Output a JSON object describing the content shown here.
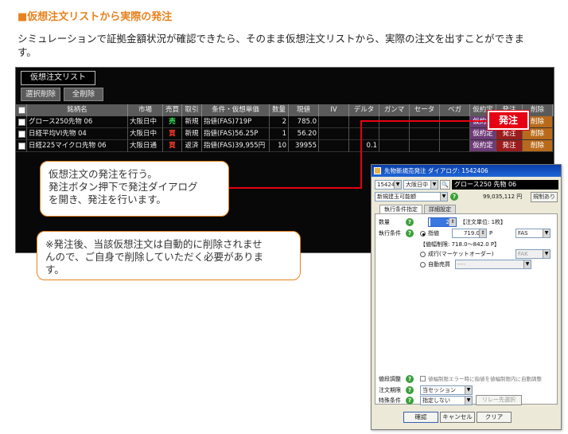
{
  "heading": "■仮想注文リストから実際の発注",
  "description": "シミュレーションで証拠金額状況が確認できたら、そのまま仮想注文リストから、実際の注文を出すことができます。",
  "list": {
    "title": "仮想注文リスト",
    "buttons": {
      "select_delete": "選択削除",
      "delete_all": "全削除"
    },
    "columns": [
      "銘柄名",
      "市場",
      "売買",
      "取引",
      "条件・仮想単価",
      "数量",
      "現値",
      "IV",
      "デルタ",
      "ガンマ",
      "セータ",
      "ベガ",
      "仮約定",
      "発注",
      "削除"
    ],
    "rows": [
      {
        "name": "グロース250先物 06",
        "market": "大阪日中",
        "side": "売",
        "side_type": "sell",
        "trade": "新規",
        "condition": "指値(FAS)719P",
        "qty": "2",
        "price": "785.0",
        "iv": "",
        "delta": "",
        "gamma": "",
        "theta": "",
        "vega": "",
        "kari": "仮約定",
        "hat": "発注",
        "del": "削除"
      },
      {
        "name": "日経平均VI先物 04",
        "market": "大阪日中",
        "side": "買",
        "side_type": "buy",
        "trade": "新規",
        "condition": "指値(FAS)56.25P",
        "qty": "1",
        "price": "56.20",
        "iv": "",
        "delta": "",
        "gamma": "",
        "theta": "",
        "vega": "",
        "kari": "仮約定",
        "hat": "発注",
        "del": "削除"
      },
      {
        "name": "日経225マイクロ先物 06",
        "market": "大阪日通",
        "side": "買",
        "side_type": "buy",
        "trade": "返済",
        "condition": "指値(FAS)39,955円",
        "qty": "10",
        "price": "39955",
        "iv": "",
        "delta": "0.1",
        "gamma": "",
        "theta": "",
        "vega": "",
        "kari": "仮約定",
        "hat": "発注",
        "del": "削除"
      }
    ]
  },
  "red_callout": "発注",
  "bubble1": {
    "line1": "仮想注文の発注を行う。",
    "line2": "発注ボタン押下で発注ダイアログ",
    "line3": "を開き、発注を行います。"
  },
  "bubble2": {
    "line1": "※発注後、当該仮想注文は自動的に削除されませ",
    "line2": "んので、ご自身で削除していただく必要がありま",
    "line3": "す。"
  },
  "dialog": {
    "title": "先物新規売発注 ダイアログ: 1542406",
    "code": "154240",
    "market": "大阪日中",
    "symbol": "グロース250 先物 06",
    "account_type": "新規建玉可能額",
    "amount": "99,035,112 円",
    "mini_button": "規制あり",
    "tabs": [
      "執行条件指定",
      "詳細設定"
    ],
    "qty_label": "数量",
    "qty_value": "2",
    "unit_text": "【注文単位: 1枚】",
    "exec_label": "執行条件",
    "limit_label": "指値",
    "limit_value": "719.0",
    "p_unit": "P",
    "fas": "FAS",
    "range_text": "【値幅制限: 718.0～842.0 P】",
    "market_order_label": "成行(マーケットオーダー)",
    "fak": "FAK",
    "auto_label": "自動売買",
    "auto_value": "----",
    "price_adjust_label": "値段調整",
    "price_adjust_text": "値幅制限エラー時に指値を値幅制限内に自動調整",
    "period_label": "注文期限",
    "period_value": "当セッション",
    "special_label": "特殊条件",
    "special_value": "指定しない",
    "relay_button": "リレー先選択",
    "buttons": {
      "confirm": "確認",
      "cancel": "キャンセル",
      "clear": "クリア"
    }
  },
  "colors": {
    "accent": "#e8821e",
    "red": "#e60012",
    "buy": "#ff3a2a",
    "sell": "#3af05a"
  }
}
